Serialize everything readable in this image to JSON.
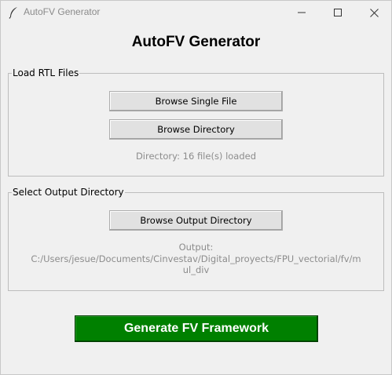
{
  "window": {
    "title": "AutoFV Generator",
    "icon": "feather-icon"
  },
  "header": {
    "title": "AutoFV Generator"
  },
  "rtl_group": {
    "legend": "Load RTL Files",
    "browse_single_label": "Browse Single File",
    "browse_directory_label": "Browse Directory",
    "status": "Directory: 16 file(s) loaded"
  },
  "output_group": {
    "legend": "Select Output Directory",
    "browse_output_label": "Browse Output Directory",
    "output_label": "Output:",
    "output_path_line1": "C:/Users/jesue/Documents/Cinvestav/Digital_proyects/FPU_vectorial/fv/m",
    "output_path_line2": "ul_div"
  },
  "actions": {
    "generate_label": "Generate FV Framework"
  },
  "colors": {
    "generate_bg": "#008000",
    "generate_text": "#ffffff",
    "status_text": "#8c8c8c"
  }
}
